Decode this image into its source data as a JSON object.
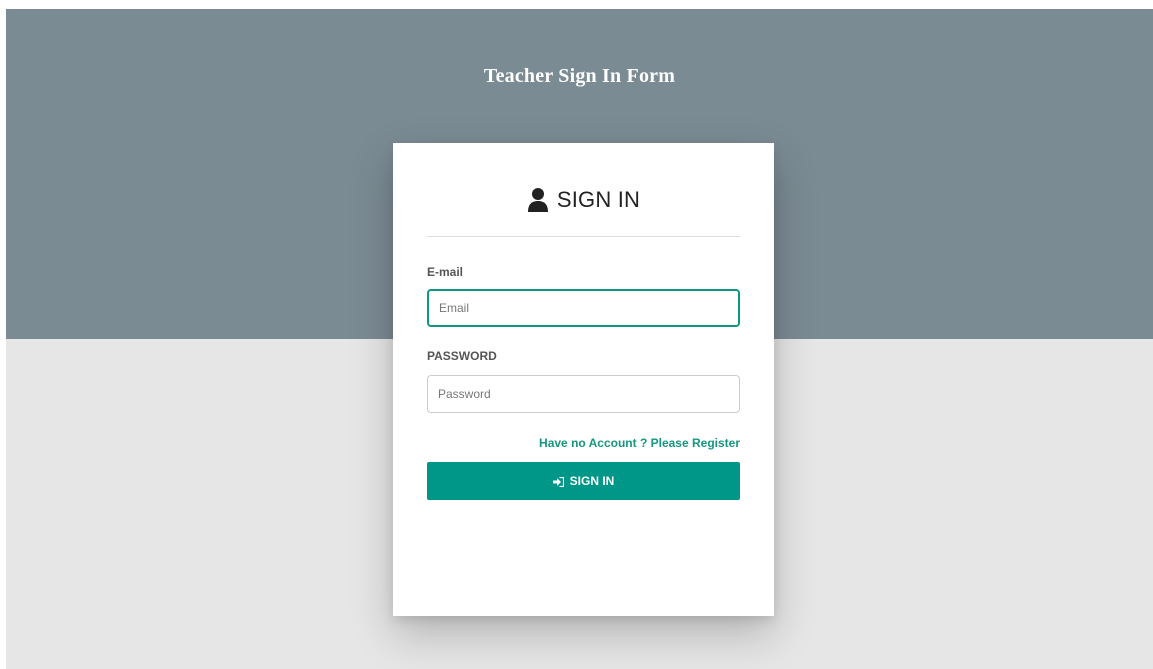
{
  "page": {
    "title": "Teacher Sign In Form"
  },
  "card": {
    "title": "SIGN IN",
    "icon": "user-icon"
  },
  "form": {
    "email_label": "E-mail",
    "email_placeholder": "Email",
    "email_value": "",
    "password_label": "PASSWORD",
    "password_placeholder": "Password",
    "password_value": "",
    "register_link": "Have no Account ? Please Register",
    "submit_label": "SIGN IN",
    "submit_icon": "sign-in-icon"
  },
  "colors": {
    "header_band": "#7b8b93",
    "page_background": "#e6e6e6",
    "accent": "#009688",
    "focus_border": "#0f9685"
  }
}
